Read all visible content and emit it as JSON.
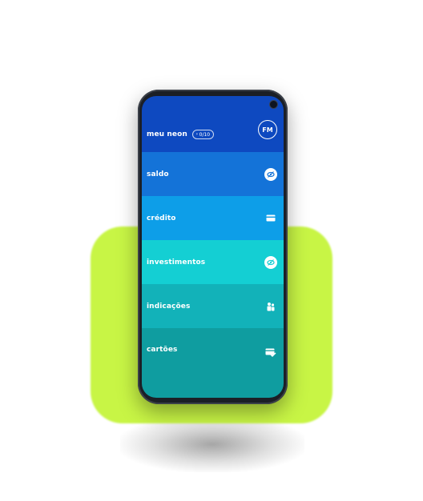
{
  "header": {
    "title": "meu neon",
    "badge": "0/10",
    "avatar": "FM"
  },
  "menu": [
    {
      "label": "saldo",
      "icon": "eye-hidden-icon",
      "color": "#1473d8"
    },
    {
      "label": "crédito",
      "icon": "card-icon",
      "color": "#0d9ee8"
    },
    {
      "label": "investimentos",
      "icon": "eye-hidden-icon",
      "color": "#14cfd3"
    },
    {
      "label": "indicações",
      "icon": "people-icon",
      "color": "#12b2b9"
    },
    {
      "label": "cartões",
      "icon": "cards-check-icon",
      "color": "#0f9da0"
    }
  ],
  "colors": {
    "header": "#0e49c0",
    "accent_blob": "#c8f545"
  }
}
